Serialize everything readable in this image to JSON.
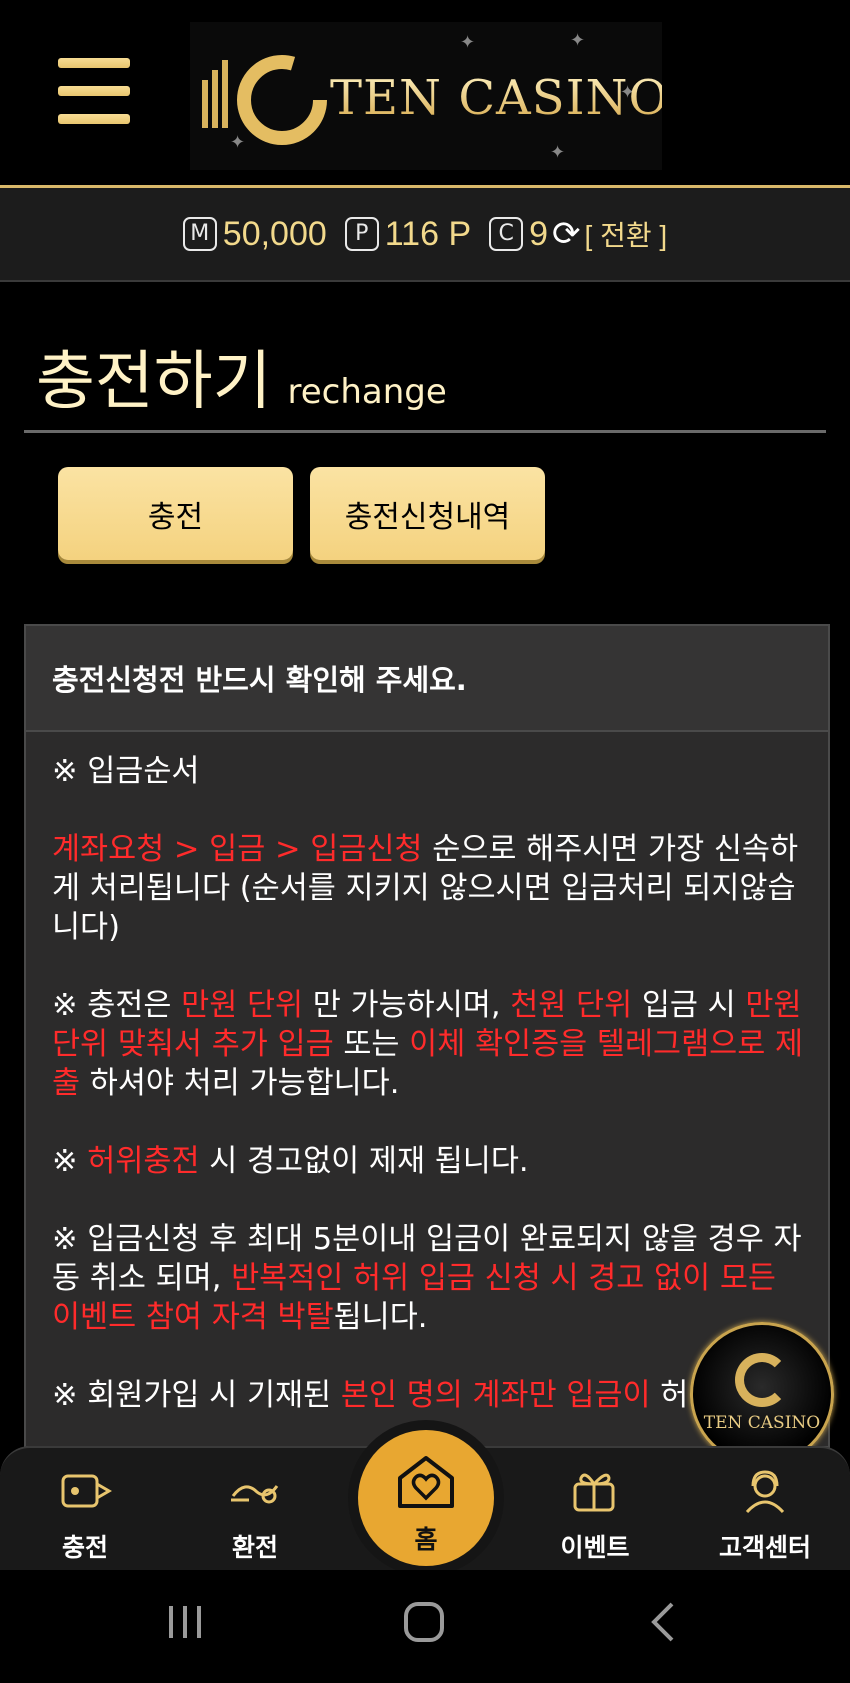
{
  "header": {
    "logo_text": "TEN CASINO",
    "menu_icon": "hamburger-menu-icon"
  },
  "balance": {
    "money_badge": "M",
    "money_value": "50,000",
    "point_badge": "P",
    "point_value": "116 P",
    "coupon_badge": "C",
    "coupon_value": "9",
    "switch_label": "[ 전환 ]"
  },
  "page": {
    "title": "충전하기",
    "subtitle": "rechange"
  },
  "tabs": {
    "charge": "충전",
    "history": "충전신청내역"
  },
  "notice": {
    "heading": "충전신청전 반드시 확인해 주세요.",
    "p1": "※ 입금순서",
    "p2_red": "계좌요청 > 입금 > 입금신청",
    "p2_rest": " 순으로 해주시면 가장 신속하게 처리됩니다 (순서를 지키지 않으시면 입금처리 되지않습니다)",
    "p3_a": "※ 충전은 ",
    "p3_b": "만원 단위",
    "p3_c": " 만 가능하시며, ",
    "p3_d": "천원 단위",
    "p3_e": " 입금 시 ",
    "p3_f": "만원 단위 맞춰서 추가 입금",
    "p3_g": " 또는 ",
    "p3_h": "이체 확인증을 텔레그램으로 제출",
    "p3_i": " 하셔야 처리 가능합니다.",
    "p4_a": "※ ",
    "p4_b": "허위충전",
    "p4_c": " 시 경고없이 제재 됩니다.",
    "p5_a": "※ 입금신청 후 최대 5분이내 입금이 완료되지 않을 경우 자동 취소 되며, ",
    "p5_b": "반복적인 허위 입금 신청 시 경고 없이 모든 이벤트 참여 자격 박탈",
    "p5_c": "됩니다.",
    "p6_a": "※ 회원가입 시 기재된 ",
    "p6_b": "본인 명의 계좌만 입금이",
    "p6_c": " 허니다"
  },
  "floating_logo_text": "TEN CASINO",
  "bottom_nav": {
    "charge": "충전",
    "exchange": "환전",
    "home": "홈",
    "event": "이벤트",
    "support": "고객센터"
  },
  "colors": {
    "gold": "#f2d98c",
    "button_gold": "#f4d27f",
    "home_orange": "#e8a731",
    "alert_red": "#ff2b2b"
  }
}
